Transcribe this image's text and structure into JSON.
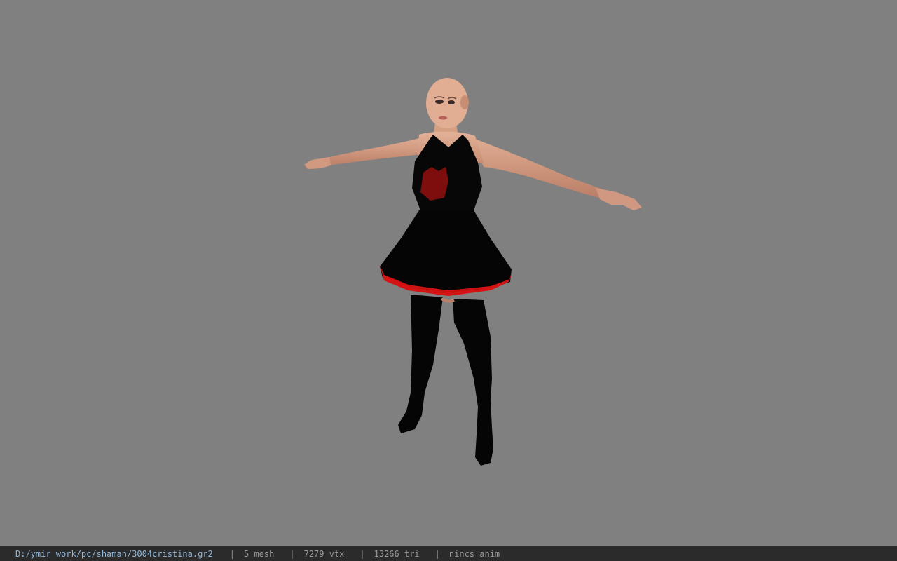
{
  "viewer": {
    "file_path": "D:/ymir work/pc/shaman/3004cristina.gr2",
    "separator": "|",
    "mesh_count": "5 mesh",
    "vertex_count": "7279 vtx",
    "triangle_count": "13266 tri",
    "anim_status": "nincs anim"
  },
  "colors": {
    "background": "#808080",
    "statusbar": "#2b2b2b",
    "path_text": "#8fb6d8",
    "stat_text": "#9a9a9a",
    "dress": "#060606",
    "trim": "#d41414",
    "skin": "#d9a58a"
  }
}
